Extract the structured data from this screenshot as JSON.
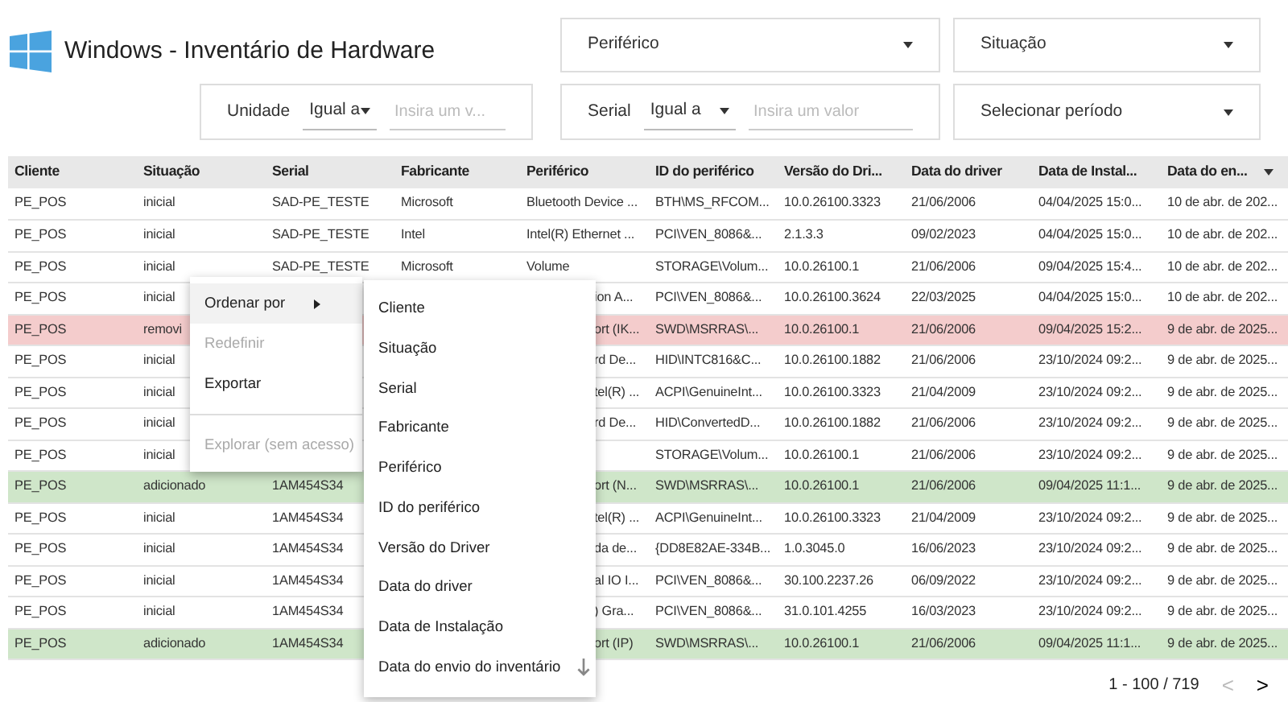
{
  "header": {
    "title": "Windows - Inventário de Hardware"
  },
  "filters": {
    "periferico": {
      "label": "Periférico"
    },
    "situacao": {
      "label": "Situação"
    },
    "unidade": {
      "label": "Unidade",
      "operator": "Igual a",
      "placeholder": "Insira um v..."
    },
    "serial": {
      "label": "Serial",
      "operator": "Igual a",
      "placeholder": "Insira um valor"
    },
    "periodo": {
      "label": "Selecionar período"
    }
  },
  "table": {
    "columns": [
      {
        "label": "Cliente",
        "sort_descending": false
      },
      {
        "label": "Situação",
        "sort_descending": false
      },
      {
        "label": "Serial",
        "sort_descending": false
      },
      {
        "label": "Fabricante",
        "sort_descending": false
      },
      {
        "label": "Periférico",
        "sort_descending": false
      },
      {
        "label": "ID do periférico",
        "sort_descending": false
      },
      {
        "label": "Versão do Dri...",
        "sort_descending": false
      },
      {
        "label": "Data do driver",
        "sort_descending": false
      },
      {
        "label": "Data de Instal...",
        "sort_descending": false
      },
      {
        "label": "Data do en...",
        "sort_descending": true
      }
    ],
    "rows": [
      {
        "cells": [
          "PE_POS",
          "inicial",
          "SAD-PE_TESTE",
          "Microsoft",
          "Bluetooth Device ...",
          "BTH\\MS_RFCOM...",
          "10.0.26100.3323",
          "21/06/2006",
          "04/04/2025 15:0...",
          "10 de abr. de 202..."
        ]
      },
      {
        "cells": [
          "PE_POS",
          "inicial",
          "SAD-PE_TESTE",
          "Intel",
          "Intel(R) Ethernet ...",
          "PCI\\VEN_8086&...",
          "2.1.3.3",
          "09/02/2023",
          "04/04/2025 15:0...",
          "10 de abr. de 202..."
        ]
      },
      {
        "cells": [
          "PE_POS",
          "inicial",
          "SAD-PE_TESTE",
          "Microsoft",
          "Volume",
          "STORAGE\\Volum...",
          "10.0.26100.1",
          "21/06/2006",
          "09/04/2025 15:4...",
          "10 de abr. de 202..."
        ]
      },
      {
        "cells": [
          "PE_POS",
          "inicial",
          null,
          null,
          {
            "text": "ion A...",
            "clipped": true
          },
          "PCI\\VEN_8086&...",
          "10.0.26100.3624",
          "22/03/2025",
          "04/04/2025 15:0...",
          "10 de abr. de 202..."
        ]
      },
      {
        "color": "#f4cccc",
        "cells": [
          "PE_POS",
          "removi",
          null,
          null,
          {
            "text": "ort (IK...",
            "clipped": true
          },
          "SWD\\MSRRAS\\...",
          "10.0.26100.1",
          "21/06/2006",
          "09/04/2025 15:2...",
          "9 de abr. de 2025..."
        ]
      },
      {
        "cells": [
          "PE_POS",
          "inicial",
          null,
          null,
          {
            "text": "rd De...",
            "clipped": true
          },
          "HID\\INTC816&C...",
          "10.0.26100.1882",
          "21/06/2006",
          "23/10/2024 09:2...",
          "9 de abr. de 2025..."
        ]
      },
      {
        "cells": [
          "PE_POS",
          "inicial",
          null,
          null,
          {
            "text": "tel(R) ...",
            "clipped": true
          },
          "ACPI\\GenuineInt...",
          "10.0.26100.3323",
          "21/04/2009",
          "23/10/2024 09:2...",
          "9 de abr. de 2025..."
        ]
      },
      {
        "cells": [
          "PE_POS",
          "inicial",
          null,
          null,
          {
            "text": "rd De...",
            "clipped": true
          },
          "HID\\ConvertedD...",
          "10.0.26100.1882",
          "21/06/2006",
          "23/10/2024 09:2...",
          "9 de abr. de 2025..."
        ]
      },
      {
        "cells": [
          "PE_POS",
          "inicial",
          null,
          null,
          null,
          "STORAGE\\Volum...",
          "10.0.26100.1",
          "21/06/2006",
          "23/10/2024 09:2...",
          "9 de abr. de 2025..."
        ]
      },
      {
        "color": "#cfe6c9",
        "cells": [
          "PE_POS",
          "adicionado",
          "1AM454S34",
          null,
          {
            "text": "ort (N...",
            "clipped": true
          },
          "SWD\\MSRRAS\\...",
          "10.0.26100.1",
          "21/06/2006",
          "09/04/2025 11:1...",
          "9 de abr. de 2025..."
        ]
      },
      {
        "cells": [
          "PE_POS",
          "inicial",
          "1AM454S34",
          null,
          {
            "text": "tel(R) ...",
            "clipped": true
          },
          "ACPI\\GenuineInt...",
          "10.0.26100.3323",
          "21/04/2009",
          "23/10/2024 09:2...",
          "9 de abr. de 2025..."
        ]
      },
      {
        "cells": [
          "PE_POS",
          "inicial",
          "1AM454S34",
          null,
          {
            "text": "da de...",
            "clipped": true
          },
          "{DD8E82AE-334B...",
          "1.0.3045.0",
          "16/06/2023",
          "23/10/2024 09:2...",
          "9 de abr. de 2025..."
        ]
      },
      {
        "cells": [
          "PE_POS",
          "inicial",
          "1AM454S34",
          null,
          {
            "text": "al IO I...",
            "clipped": true
          },
          "PCI\\VEN_8086&...",
          "30.100.2237.26",
          "06/09/2022",
          "23/10/2024 09:2...",
          "9 de abr. de 2025..."
        ]
      },
      {
        "cells": [
          "PE_POS",
          "inicial",
          "1AM454S34",
          null,
          {
            "text": ") Gra...",
            "clipped": true
          },
          "PCI\\VEN_8086&...",
          "31.0.101.4255",
          "16/03/2023",
          "23/10/2024 09:2...",
          "9 de abr. de 2025..."
        ]
      },
      {
        "color": "#cfe6c9",
        "cells": [
          "PE_POS",
          "adicionado",
          "1AM454S34",
          null,
          {
            "text": "ort (IP)",
            "clipped": true
          },
          "SWD\\MSRRAS\\...",
          "10.0.26100.1",
          "21/06/2006",
          "09/04/2025 11:1...",
          "9 de abr. de 2025..."
        ]
      }
    ]
  },
  "pagination": {
    "range": "1 - 100 / 719",
    "prev": "<",
    "next": ">",
    "prev_disabled": true
  },
  "context_menu": {
    "items": [
      {
        "label": "Ordenar por",
        "kind": "submenu",
        "disabled": false
      },
      {
        "label": "Redefinir",
        "kind": "item",
        "disabled": true
      },
      {
        "label": "Exportar",
        "kind": "item",
        "disabled": false
      },
      {
        "kind": "divider"
      },
      {
        "label": "Explorar (sem acesso)",
        "kind": "item",
        "disabled": true
      }
    ]
  },
  "sort_menu": {
    "items": [
      {
        "label": "Cliente",
        "sort_descending": false
      },
      {
        "label": "Situação",
        "sort_descending": false
      },
      {
        "label": "Serial",
        "sort_descending": false
      },
      {
        "label": "Fabricante",
        "sort_descending": false
      },
      {
        "label": "Periférico",
        "sort_descending": false
      },
      {
        "label": "ID do periférico",
        "sort_descending": false
      },
      {
        "label": "Versão do Driver",
        "sort_descending": false
      },
      {
        "label": "Data do driver",
        "sort_descending": false
      },
      {
        "label": "Data de Instalação",
        "sort_descending": false
      },
      {
        "label": "Data do envio do inventário",
        "sort_descending": true
      }
    ]
  }
}
